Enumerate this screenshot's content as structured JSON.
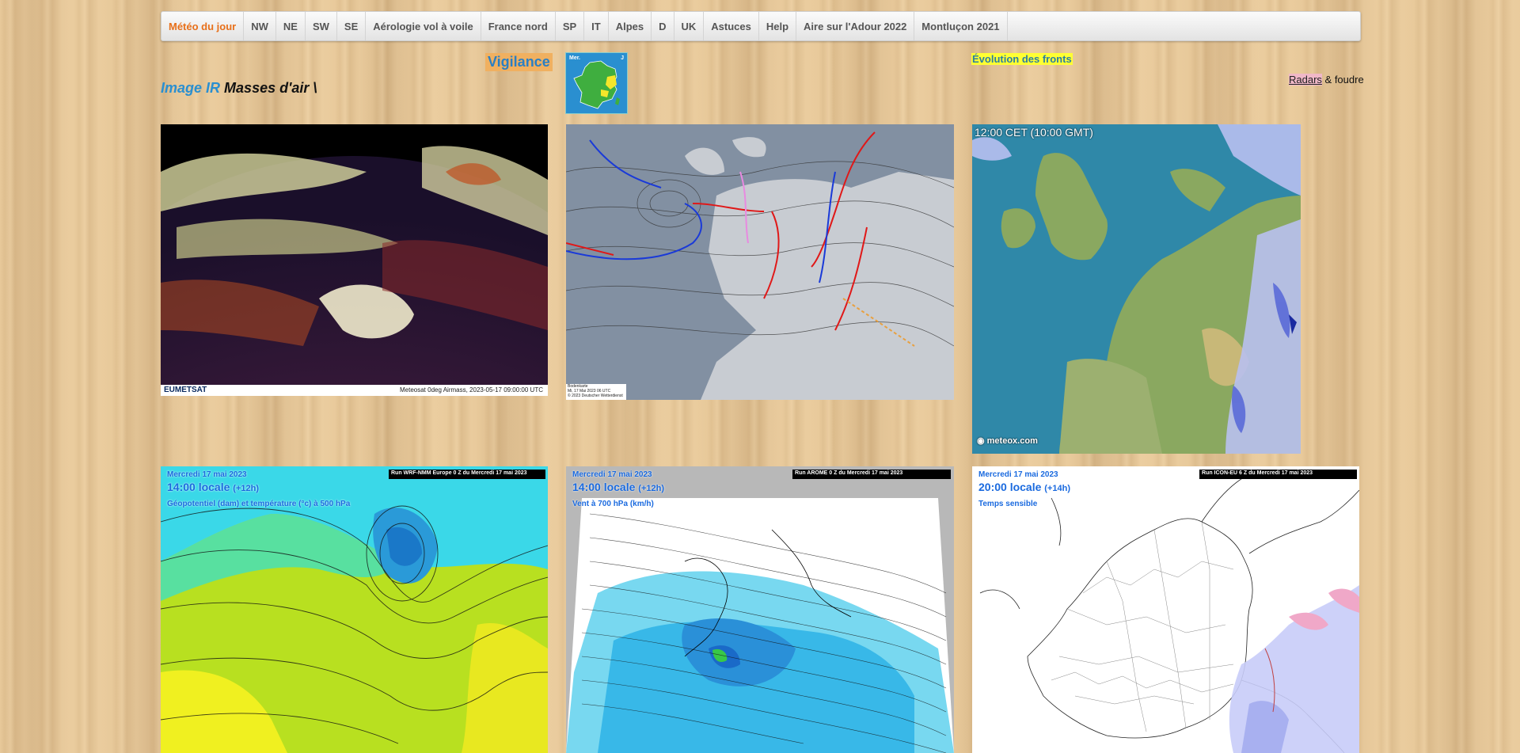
{
  "nav": {
    "items": [
      {
        "label": "Météo du jour",
        "active": true
      },
      {
        "label": "NW"
      },
      {
        "label": "NE"
      },
      {
        "label": "SW"
      },
      {
        "label": "SE"
      },
      {
        "label": "Aérologie vol à voile"
      },
      {
        "label": "France nord"
      },
      {
        "label": "SP"
      },
      {
        "label": "IT"
      },
      {
        "label": "Alpes"
      },
      {
        "label": "D"
      },
      {
        "label": "UK"
      },
      {
        "label": "Astuces"
      },
      {
        "label": "Help"
      },
      {
        "label": "Aire sur l'Adour 2022"
      },
      {
        "label": "Montluçon 2021"
      }
    ],
    "active_color": "#e8701a"
  },
  "header": {
    "image_ir": "Image IR",
    "masses_air": "Masses d'air \\",
    "vigilance": "Vigilance",
    "fronts": "Évolution des fronts",
    "radars": "Radars",
    "foudre": " & foudre"
  },
  "vigilance_map": {
    "label_left": "Mer.",
    "label_right": "J"
  },
  "panels": {
    "airmass": {
      "logo": "EUMETSAT",
      "caption": "Meteosat 0deg Airmass, 2023-05-17 09:00:00 UTC"
    },
    "fronts": {
      "footer1": "Bodenkarte",
      "footer2": "Mi, 17 Mai 2023 06 UTC",
      "footer3": "© 2023 Deutscher Wetterdienst"
    },
    "radar": {
      "time": "12:00 CET (10:00 GMT)",
      "brand": "meteox.com"
    },
    "wrf": {
      "date": "Mercredi 17 mai 2023",
      "hour": "14:00 locale",
      "hour_offset": "(+12h)",
      "field": "Géopotentiel (dam) et température (°c) à 500 hPa",
      "run": "Run WRF-NMM Europe 0 Z du Mercredi 17 mai 2023"
    },
    "arome": {
      "date": "Mercredi 17 mai 2023",
      "hour": "14:00 locale",
      "hour_offset": "(+12h)",
      "field": "Vent à 700 hPa (km/h)",
      "run": "Run AROME 0 Z du Mercredi 17 mai 2023"
    },
    "icon": {
      "date": "Mercredi 17 mai 2023",
      "hour": "20:00 locale",
      "hour_offset": "(+14h)",
      "field": "Temps sensible",
      "run": "Run ICON-EU 6 Z du Mercredi 17 mai 2023"
    }
  },
  "colors": {
    "link_blue": "#2a8fd0",
    "vigilance_bg": "#f0b060",
    "fronts_bg": "#ffff33",
    "radars_bg": "#f0b8c8"
  }
}
